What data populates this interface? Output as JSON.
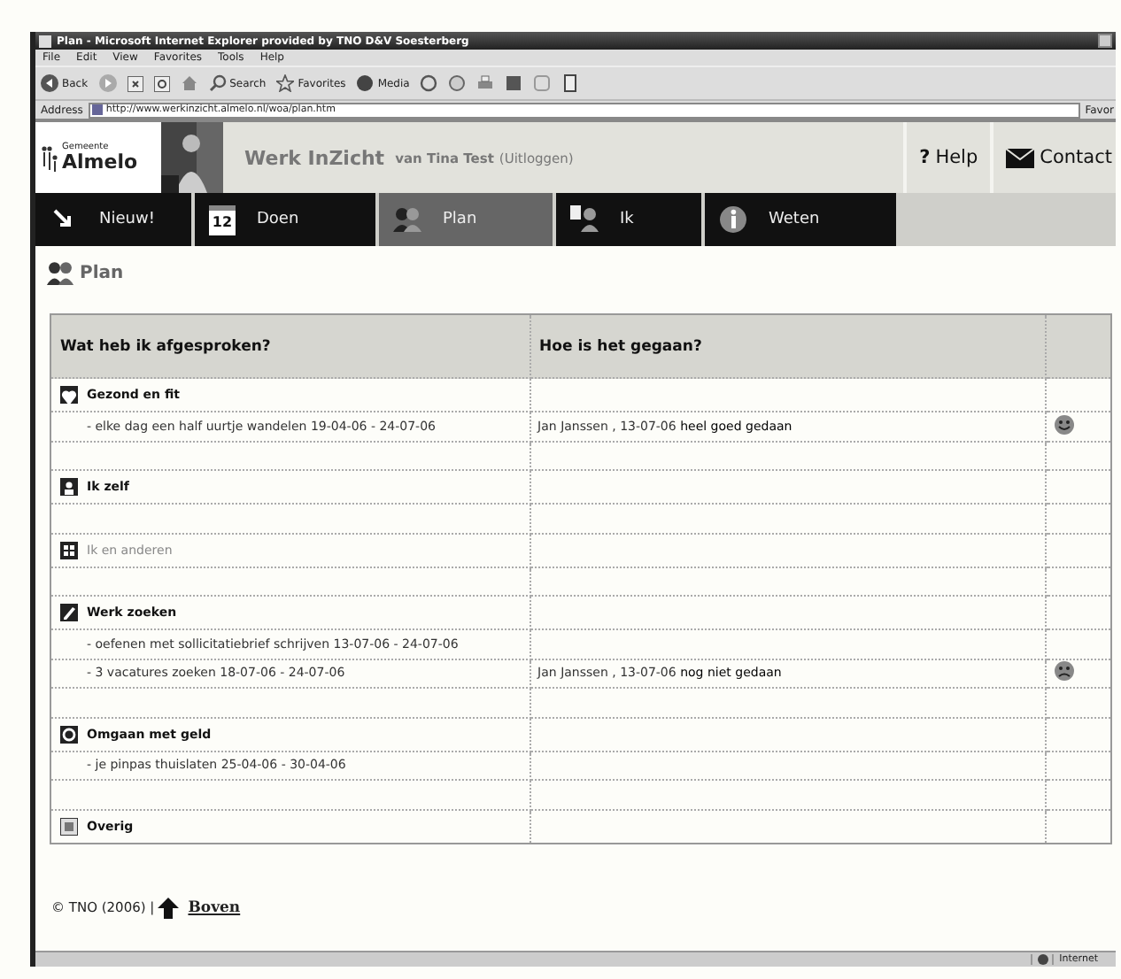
{
  "window": {
    "title": "Plan - Microsoft Internet Explorer provided by TNO D&V Soesterberg"
  },
  "menu": [
    "File",
    "Edit",
    "View",
    "Favorites",
    "Tools",
    "Help"
  ],
  "toolbar": {
    "back": "Back",
    "search": "Search",
    "favorites": "Favorites",
    "media": "Media"
  },
  "address_bar": {
    "label": "Address",
    "url": "http://www.werkinzicht.almelo.nl/woa/plan.htm",
    "side": "Favor"
  },
  "site_header": {
    "municipality": "Gemeente",
    "logo": "Almelo",
    "app": "Werk InZicht",
    "user": "van Tina Test",
    "logout": "(Uitloggen)",
    "help_mark": "?",
    "help": "Help",
    "contact": "Contact"
  },
  "tabs": [
    {
      "label": "Nieuw!",
      "selected": false
    },
    {
      "label": "Doen",
      "badge": "12",
      "selected": false
    },
    {
      "label": "Plan",
      "selected": true
    },
    {
      "label": "Ik",
      "selected": false
    },
    {
      "label": "Weten",
      "selected": false
    }
  ],
  "page_title": "Plan",
  "table": {
    "columns": [
      "Wat heb ik afgesproken?",
      "Hoe is het gegaan?"
    ],
    "rows": [
      {
        "kind": "category",
        "text": "Gezond en fit",
        "disabled": false
      },
      {
        "kind": "item",
        "text": "- elke dag een half uurtje wandelen 19-04-06 - 24-07-06",
        "result": "Jan Janssen , 13-07-06",
        "verdict": "heel goed gedaan",
        "happy": true
      },
      {
        "kind": "blank"
      },
      {
        "kind": "category",
        "text": "Ik zelf",
        "disabled": false
      },
      {
        "kind": "blank"
      },
      {
        "kind": "category",
        "text": "Ik en anderen",
        "disabled": true
      },
      {
        "kind": "blank"
      },
      {
        "kind": "category",
        "text": "Werk zoeken",
        "disabled": false
      },
      {
        "kind": "item",
        "text": "- oefenen met sollicitatiebrief schrijven 13-07-06 - 24-07-06"
      },
      {
        "kind": "item",
        "text": "- 3 vacatures zoeken 18-07-06 - 24-07-06",
        "result": "Jan Janssen , 13-07-06",
        "verdict": "nog niet gedaan",
        "happy": false
      },
      {
        "kind": "blank"
      },
      {
        "kind": "category",
        "text": "Omgaan met geld",
        "disabled": false
      },
      {
        "kind": "item",
        "text": "- je pinpas thuislaten 25-04-06 - 30-04-06"
      },
      {
        "kind": "blank"
      },
      {
        "kind": "category",
        "text": "Overig",
        "disabled": false
      }
    ]
  },
  "footer": {
    "copyright": "© TNO (2006) |",
    "link": "Boven"
  },
  "status_bar": {
    "zone": "Internet"
  }
}
